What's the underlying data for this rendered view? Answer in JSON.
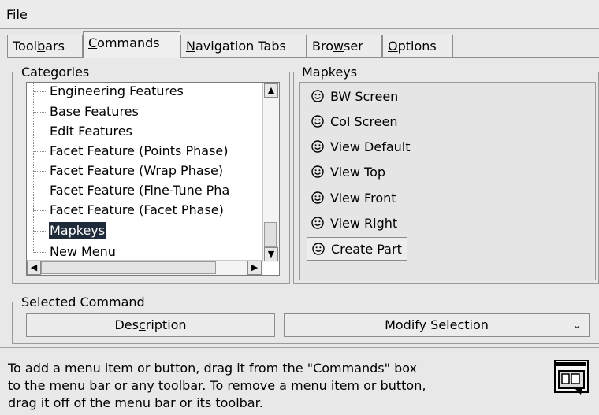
{
  "menubar": {
    "file": "File"
  },
  "tabs": [
    {
      "label": "Toolbars",
      "active": false
    },
    {
      "label": "Commands",
      "active": true
    },
    {
      "label": "Navigation Tabs",
      "active": false
    },
    {
      "label": "Browser",
      "active": false
    },
    {
      "label": "Options",
      "active": false
    }
  ],
  "categories": {
    "legend": "Categories",
    "items": [
      "Engineering Features",
      "Base Features",
      "Edit Features",
      "Facet Feature (Points Phase)",
      "Facet Feature (Wrap Phase)",
      "Facet Feature (Fine-Tune Pha",
      "Facet Feature (Facet Phase)",
      "Mapkeys",
      "New Menu"
    ],
    "selected": "Mapkeys"
  },
  "mapkeys": {
    "legend": "Mapkeys",
    "items": [
      "BW Screen",
      "Col Screen",
      "View Default",
      "View Top",
      "View Front",
      "View Right",
      "Create Part"
    ],
    "icon": "smiley-icon"
  },
  "selected_command": {
    "legend": "Selected Command",
    "description_button": "Description",
    "modify_button": "Modify Selection"
  },
  "status": {
    "text": "To add a menu item or button, drag it from the \"Commands\" box\nto the menu bar or any toolbar.  To remove a menu item or button,\ndrag it off of the menu bar or its toolbar."
  }
}
